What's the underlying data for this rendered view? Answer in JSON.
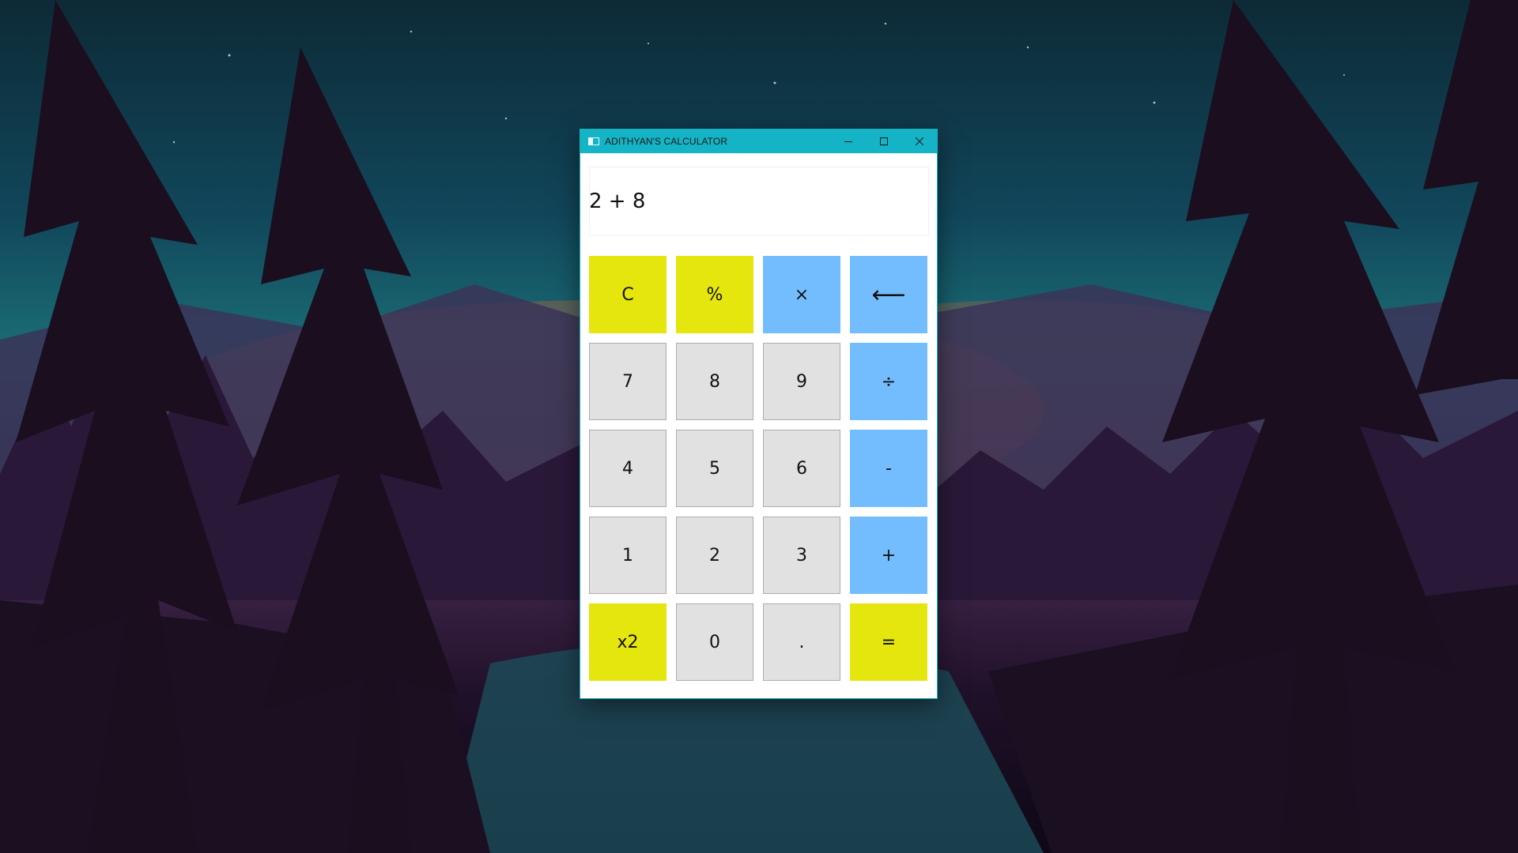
{
  "window": {
    "title": "ADITHYAN'S CALCULATOR",
    "icon": "app-window-icon",
    "controls": {
      "minimize": "minimize-icon",
      "maximize": "maximize-icon",
      "close": "close-icon"
    },
    "titlebar_color": "#14b3c5"
  },
  "display": {
    "value": "2 + 8"
  },
  "keypad": {
    "colors": {
      "function": "#e6e60f",
      "operator": "#73bdff",
      "number": "#e1e1e1"
    },
    "keys": [
      {
        "label": "C",
        "type": "fn",
        "name": "clear-button"
      },
      {
        "label": "%",
        "type": "fn",
        "name": "percent-button"
      },
      {
        "label": "×",
        "type": "op",
        "name": "multiply-button"
      },
      {
        "label": "⟵",
        "type": "op",
        "name": "backspace-button"
      },
      {
        "label": "7",
        "type": "num",
        "name": "digit-7-button"
      },
      {
        "label": "8",
        "type": "num",
        "name": "digit-8-button"
      },
      {
        "label": "9",
        "type": "num",
        "name": "digit-9-button"
      },
      {
        "label": "÷",
        "type": "op",
        "name": "divide-button"
      },
      {
        "label": "4",
        "type": "num",
        "name": "digit-4-button"
      },
      {
        "label": "5",
        "type": "num",
        "name": "digit-5-button"
      },
      {
        "label": "6",
        "type": "num",
        "name": "digit-6-button"
      },
      {
        "label": "-",
        "type": "op",
        "name": "subtract-button"
      },
      {
        "label": "1",
        "type": "num",
        "name": "digit-1-button"
      },
      {
        "label": "2",
        "type": "num",
        "name": "digit-2-button"
      },
      {
        "label": "3",
        "type": "num",
        "name": "digit-3-button"
      },
      {
        "label": "+",
        "type": "op",
        "name": "add-button"
      },
      {
        "label": "x2",
        "type": "fn",
        "name": "square-button"
      },
      {
        "label": "0",
        "type": "num",
        "name": "digit-0-button"
      },
      {
        "label": ".",
        "type": "num",
        "name": "decimal-point-button"
      },
      {
        "label": "=",
        "type": "fn",
        "name": "equals-button"
      }
    ]
  }
}
